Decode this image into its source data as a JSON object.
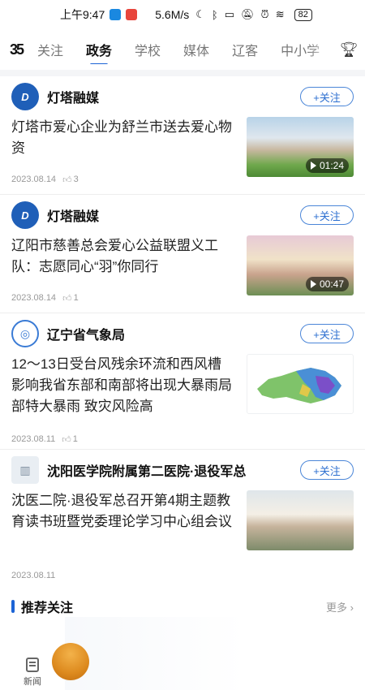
{
  "status_bar": {
    "time": "上午9:47",
    "speed": "5.6M/s",
    "battery": "82"
  },
  "nav": {
    "logo": "35",
    "tabs": [
      "关注",
      "政务",
      "学校",
      "媒体",
      "辽客",
      "中小学"
    ],
    "active_tab": "政务"
  },
  "feed": [
    {
      "source": "灯塔融媒",
      "follow": "+关注",
      "title": "灯塔市爱心企业为舒兰市送去爱心物资",
      "date": "2023.08.14",
      "likes": "3",
      "duration": "01:24"
    },
    {
      "source": "灯塔融媒",
      "follow": "+关注",
      "title": "辽阳市慈善总会爱心公益联盟义工队：志愿同心“羽”你同行",
      "date": "2023.08.14",
      "likes": "1",
      "duration": "00:47"
    },
    {
      "source": "辽宁省气象局",
      "follow": "+关注",
      "title": "12～13日受台风残余环流和西风槽影响我省东部和南部将出现大暴雨局部特大暴雨 致灾风险高",
      "date": "2023.08.11",
      "likes": "1"
    },
    {
      "source": "沈阳医学院附属第二医院·退役军总",
      "follow": "+关注",
      "title": "沈医二院·退役军总召开第4期主题教育读书班暨党委理论学习中心组会议",
      "date": "2023.08.11"
    }
  ],
  "recommend": {
    "title": "推荐关注",
    "more": "更多"
  },
  "bottom_tab": {
    "label": "新闻"
  },
  "colors": {
    "accent": "#1c64d6",
    "follow_border": "#4b86d8"
  },
  "icons": [
    "logo-icon",
    "trophy-icon",
    "like-icon",
    "play-icon",
    "news-icon",
    "chevron-right-icon"
  ]
}
